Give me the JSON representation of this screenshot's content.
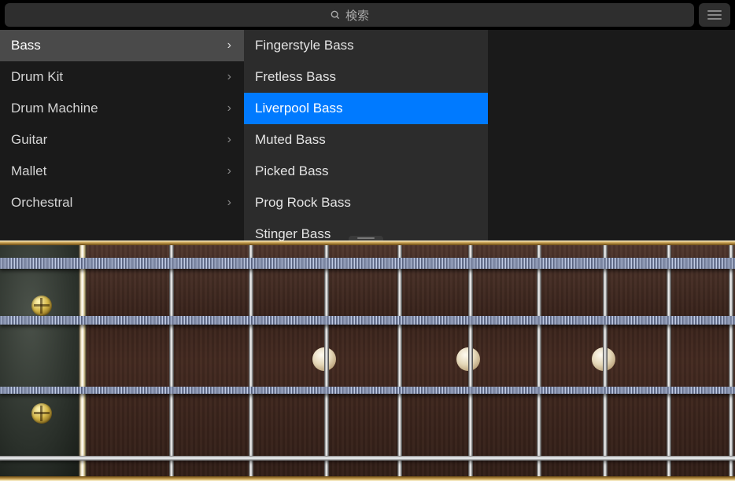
{
  "search": {
    "placeholder": "検索"
  },
  "categories": {
    "selected_index": 0,
    "items": [
      {
        "label": "Bass"
      },
      {
        "label": "Drum Kit"
      },
      {
        "label": "Drum Machine"
      },
      {
        "label": "Guitar"
      },
      {
        "label": "Mallet"
      },
      {
        "label": "Orchestral"
      }
    ]
  },
  "subcategories": {
    "selected_index": 2,
    "items": [
      {
        "label": "Fingerstyle Bass"
      },
      {
        "label": "Fretless Bass"
      },
      {
        "label": "Liverpool Bass"
      },
      {
        "label": "Muted Bass"
      },
      {
        "label": "Picked Bass"
      },
      {
        "label": "Prog Rock Bass"
      },
      {
        "label": "Stinger Bass"
      }
    ]
  },
  "instrument": {
    "type": "bass",
    "strings": 4,
    "fret_markers": [
      3,
      5,
      7
    ],
    "visible_frets": 8
  }
}
